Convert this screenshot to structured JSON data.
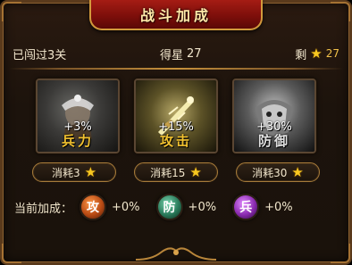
{
  "title": "战斗加成",
  "stats": {
    "passed_text": "已闯过3关",
    "stars_label": "得星",
    "stars_value": "27",
    "remaining_label": "剩",
    "remaining_value": "27"
  },
  "cards": [
    {
      "key": "soldier",
      "percent": "+3%",
      "label": "兵力"
    },
    {
      "key": "attack",
      "percent": "+15%",
      "label": "攻击"
    },
    {
      "key": "defense",
      "percent": "+30%",
      "label": "防御"
    }
  ],
  "costs": [
    {
      "label": "消耗3"
    },
    {
      "label": "消耗15"
    },
    {
      "label": "消耗30"
    }
  ],
  "current": {
    "label": "当前加成：",
    "bonuses": [
      {
        "badge": "攻",
        "value": "+0%"
      },
      {
        "badge": "防",
        "value": "+0%"
      },
      {
        "badge": "兵",
        "value": "+0%"
      }
    ]
  },
  "icons": {
    "star": "star-icon",
    "soldier": "soldier-icon",
    "attack": "sword-icon",
    "defense": "armor-icon"
  },
  "colors": {
    "banner": "#a51c14",
    "gold": "#f2c230",
    "star": "#f8c820"
  }
}
